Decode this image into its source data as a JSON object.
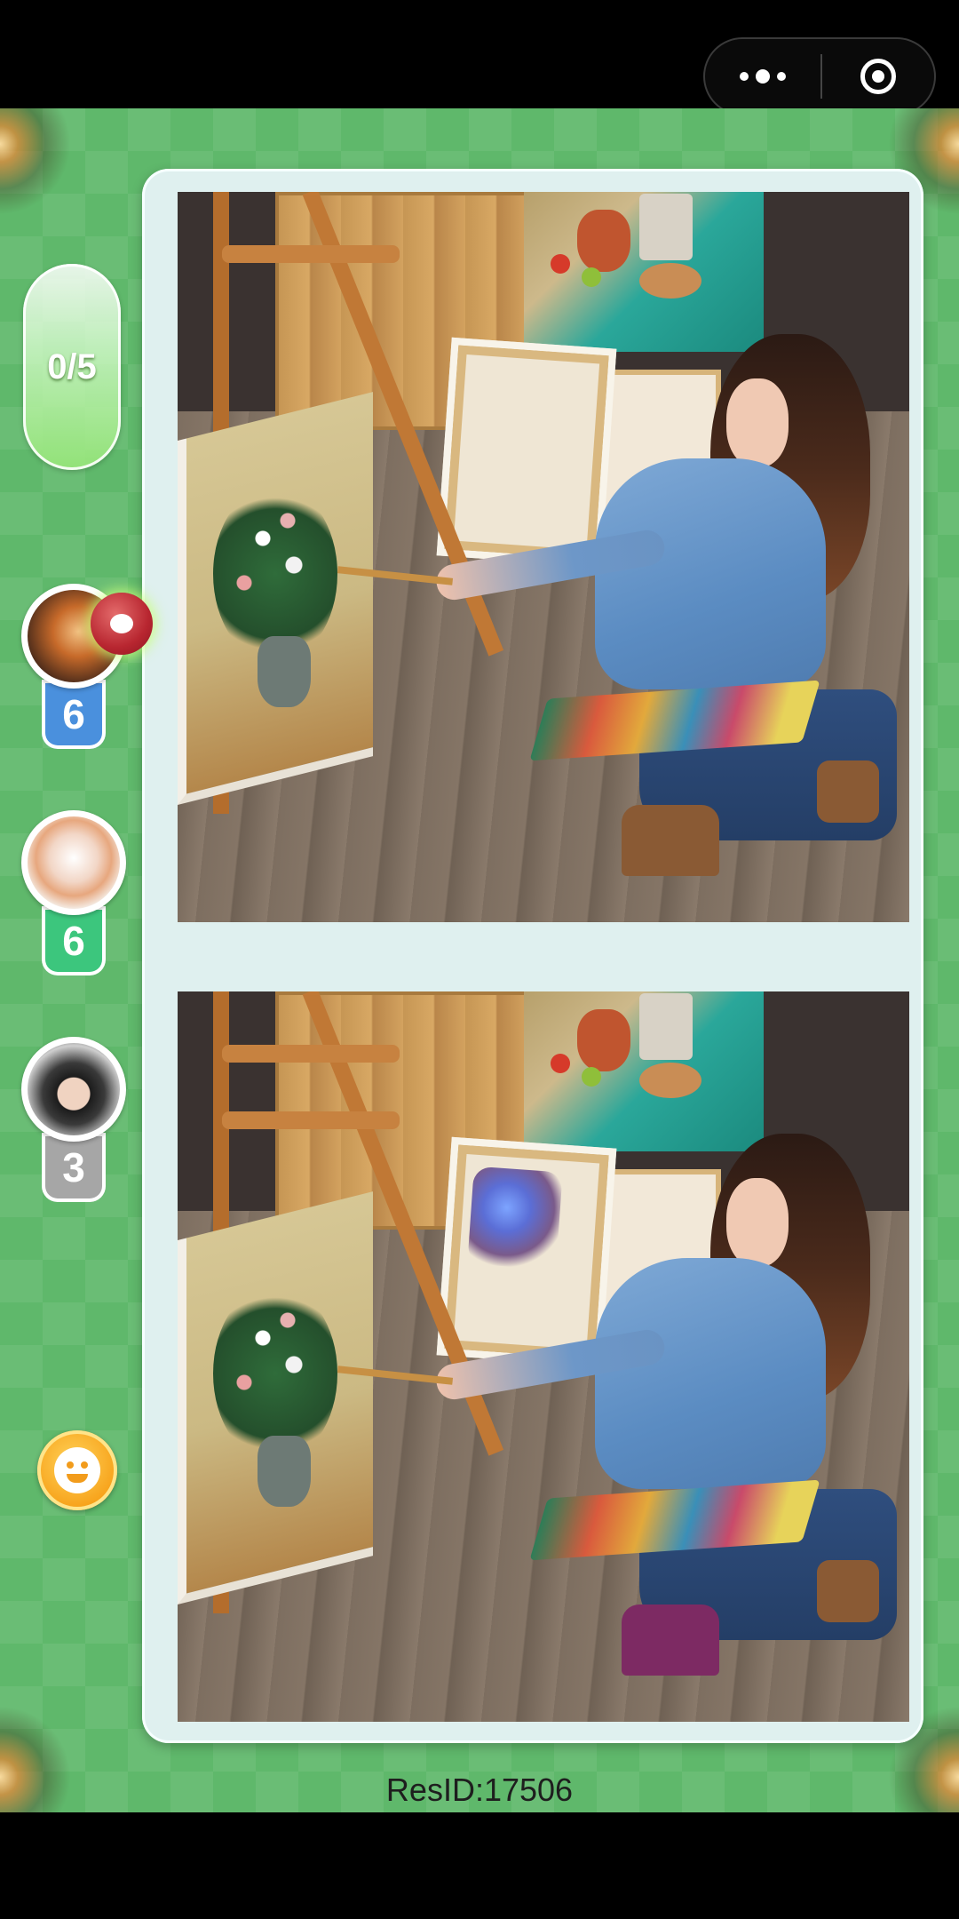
{
  "capsule": {
    "more_icon": "more-dots-icon",
    "close_icon": "target-circle-icon"
  },
  "progress": {
    "found_label": "0/5"
  },
  "players": [
    {
      "score": "6",
      "color": "#4a90dd",
      "has_hint": true
    },
    {
      "score": "6",
      "color": "#3cc67d",
      "has_hint": false
    },
    {
      "score": "3",
      "color": "#a6a6a6",
      "has_hint": false
    }
  ],
  "emoji_button": {
    "icon": "smile-icon"
  },
  "footer": {
    "res_id": "ResID:17506"
  },
  "colors": {
    "background_green": "#5fb86b",
    "frame": "#dff0ef"
  }
}
